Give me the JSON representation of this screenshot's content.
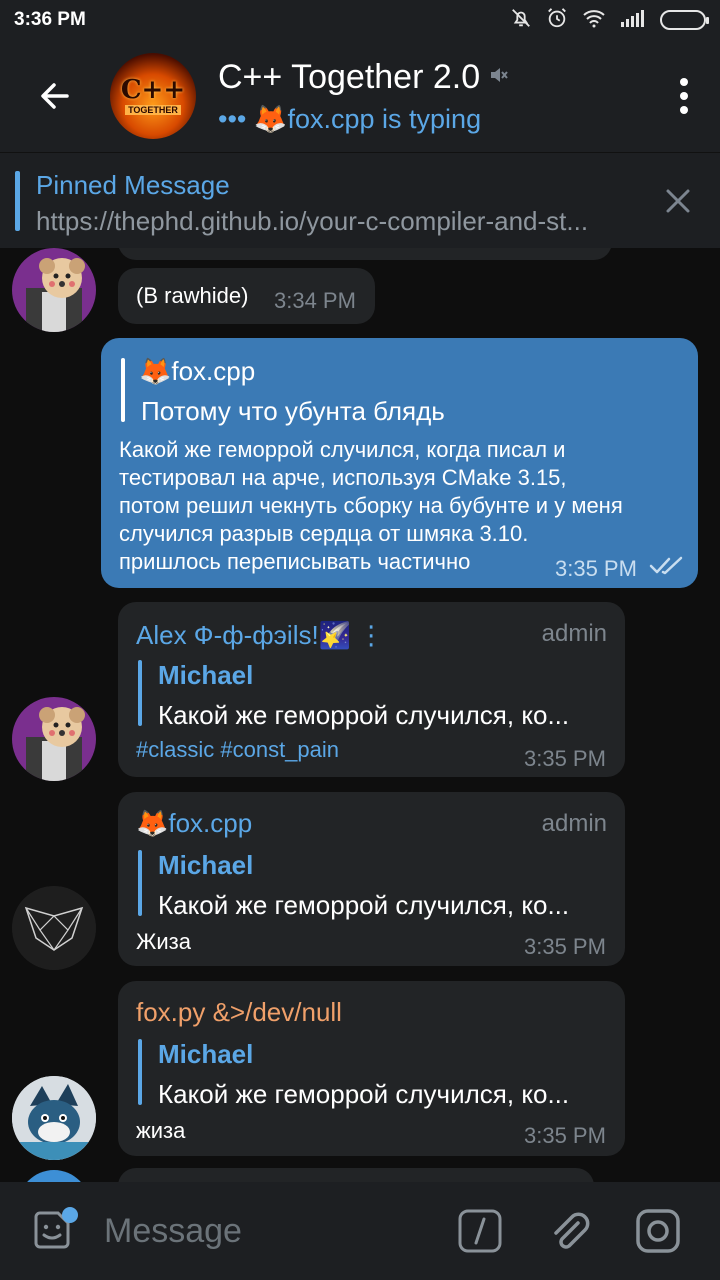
{
  "status_bar": {
    "time": "3:36 PM"
  },
  "header": {
    "avatar_text_big": "C++",
    "avatar_text_small": "TOGETHER",
    "title": "C++ Together 2.0",
    "typing": "••• 🦊fox.cpp is typing"
  },
  "pinned": {
    "title": "Pinned Message",
    "text": "https://thephd.github.io/your-c-compiler-and-st..."
  },
  "messages": [
    {
      "text": "(В rawhide)",
      "time": "3:34 PM"
    },
    {
      "reply_name": "🦊fox.cpp",
      "reply_text": "Потому что убунта блядь",
      "text_lines": [
        "Какой же геморрой случился, когда писал и",
        "тестировал на арче, используя CMake 3.15,",
        "потом решил чекнуть сборку на бубунте и у меня",
        "случился разрыв сердца от шмяка 3.10.",
        "пришлось переписывать частично"
      ],
      "time": "3:35 PM"
    },
    {
      "sender": "Alex Ф-ф-фэils!🌠 ⋮",
      "rank": "admin",
      "reply_name": "Michael",
      "reply_text": "Какой же геморрой случился, ко...",
      "text": "#classic #const_pain",
      "time": "3:35 PM"
    },
    {
      "sender": "🦊fox.cpp",
      "rank": "admin",
      "reply_name": "Michael",
      "reply_text": "Какой же геморрой случился, ко...",
      "text": "Жиза",
      "time": "3:35 PM"
    },
    {
      "sender": "fox.py &>/dev/null",
      "reply_name": "Michael",
      "reply_text": "Какой же геморрой случился, ко...",
      "text": "жиза",
      "time": "3:35 PM"
    }
  ],
  "input": {
    "placeholder": "Message"
  },
  "colors": {
    "accent": "#5ba7e6",
    "outgoing_bubble": "#3b7ab5",
    "incoming_bubble": "#222426",
    "sender_fox_py": "#f0a06a",
    "header_bg": "#1d1f22"
  }
}
